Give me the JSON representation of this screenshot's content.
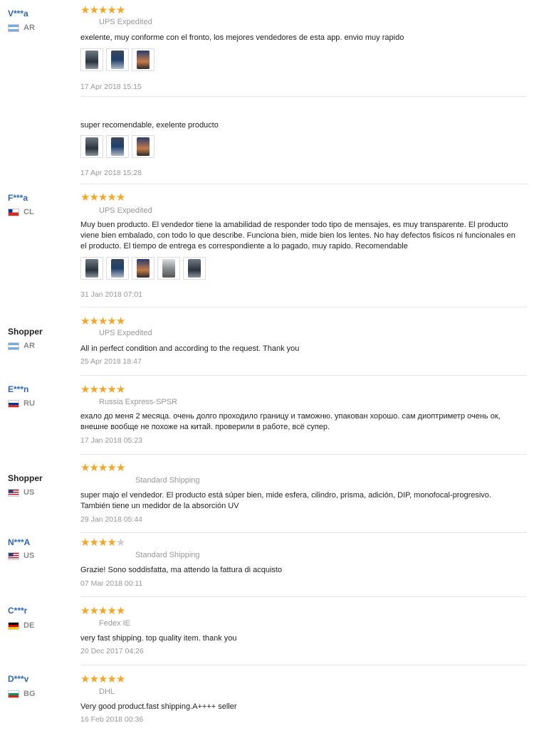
{
  "reviews": [
    {
      "user": "V***a",
      "masked": true,
      "country": "AR",
      "flag": "ar",
      "stars": 5,
      "shipping": "UPS Expedited",
      "text": "exelente, muy conforme con el fronto, los mejores vendedores de esta app. envio muy rapido",
      "photos": 3,
      "date": "17 Apr 2018 15:15"
    },
    {
      "user": "",
      "masked": false,
      "country": "",
      "flag": "",
      "stars": 0,
      "shipping": "",
      "text": "super recomendable, exelente producto",
      "photos": 3,
      "date": "17 Apr 2018 15:28"
    },
    {
      "user": "F***a",
      "masked": true,
      "country": "CL",
      "flag": "cl",
      "stars": 5,
      "shipping": "UPS Expedited",
      "text": "Muy buen producto. El vendedor tiene la amabilidad de responder todo tipo de mensajes, es muy transparente. El producto viene bien embalado, con todo lo que describe. Funciona bien, mide bien los lentes. No hay defectos fisicos ni funcionales en el producto. El tiempo de entrega es correspondiente a lo pagado, muy rapido. Recomendable",
      "photos": 5,
      "date": "31 Jan 2018 07:01"
    },
    {
      "user": "Shopper",
      "masked": false,
      "country": "AR",
      "flag": "ar",
      "stars": 5,
      "shipping": "UPS Expedited",
      "text": "All in perfect condition and according to the request. Thank you",
      "photos": 0,
      "date": "25 Apr 2018 18:47"
    },
    {
      "user": "E***n",
      "masked": true,
      "country": "RU",
      "flag": "ru",
      "stars": 5,
      "shipping": "Russia Express-SPSR",
      "text": "ехало до меня 2 месяца. очень долго проходило границу и таможню. упакован хорошо. сам диоптриметр очень ок, внешне вообще не похоже на китай. проверили в работе, всё супер.",
      "photos": 0,
      "date": "17 Jan 2018 05:23"
    },
    {
      "user": "Shopper",
      "masked": false,
      "country": "US",
      "flag": "us",
      "stars": 5,
      "shipping": "Standard Shipping",
      "text": "super majo el vendedor. El producto está súper bien, mide esfera, cilindro, prisma, adición, DIP, monofocal-progresivo. También tiene un medidor de la absorción UV",
      "photos": 0,
      "date": "29 Jan 2018 05:44"
    },
    {
      "user": "N***A",
      "masked": true,
      "country": "US",
      "flag": "us",
      "stars": 4,
      "shipping": "Standard Shipping",
      "text": "Grazie! Sono soddisfatta, ma attendo la fattura di acquisto",
      "photos": 0,
      "date": "07 Mar 2018 00:11"
    },
    {
      "user": "C***r",
      "masked": true,
      "country": "DE",
      "flag": "de",
      "stars": 5,
      "shipping": "Fedex IE",
      "text": "very fast shipping. top quality item. thank you",
      "photos": 0,
      "date": "20 Dec 2017 04:26"
    },
    {
      "user": "D***v",
      "masked": true,
      "country": "BG",
      "flag": "bg",
      "stars": 5,
      "shipping": "DHL",
      "text": "Very good product.fast shipping.A++++ seller",
      "photos": 0,
      "date": "16 Feb 2018 00:36"
    }
  ],
  "colors": {
    "star": "#f6a623",
    "star_off": "#cccccc",
    "masked_user": "#2e68b5",
    "separator": "#e5e5e5"
  },
  "icons": {
    "star": "star-icon",
    "photo": "review-photo-thumbnail"
  }
}
